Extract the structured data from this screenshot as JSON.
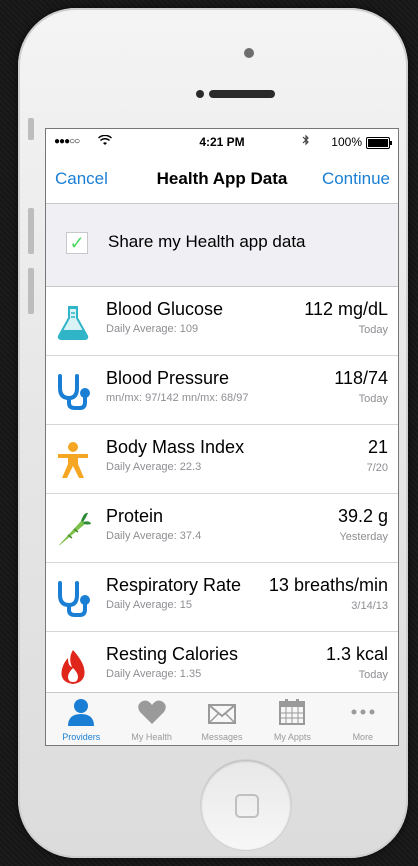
{
  "status_bar": {
    "signal": "●●●○○",
    "wifi_icon": "wifi-icon",
    "time": "4:21 PM",
    "bluetooth_icon": "bluetooth-icon",
    "battery_percent": "100%"
  },
  "nav": {
    "cancel": "Cancel",
    "title": "Health App Data",
    "continue": "Continue"
  },
  "share": {
    "checked": true,
    "check_mark": "✓",
    "label": "Share my Health app data"
  },
  "rows": [
    {
      "icon": "flask-icon",
      "name": "Blood Glucose",
      "sub": "Daily Average: 109",
      "value": "112 mg/dL",
      "date": "Today"
    },
    {
      "icon": "stethoscope-icon",
      "name": "Blood Pressure",
      "sub": "mn/mx: 97/142   mn/mx: 68/97",
      "value": "118/74",
      "date": "Today"
    },
    {
      "icon": "person-icon",
      "name": "Body Mass Index",
      "sub": "Daily Average: 22.3",
      "value": "21",
      "date": "7/20"
    },
    {
      "icon": "carrot-icon",
      "name": "Protein",
      "sub": "Daily Average: 37.4",
      "value": "39.2 g",
      "date": "Yesterday"
    },
    {
      "icon": "stethoscope-icon",
      "name": "Respiratory Rate",
      "sub": "Daily Average: 15",
      "value": "13 breaths/min",
      "date": "3/14/13"
    },
    {
      "icon": "flame-icon",
      "name": "Resting Calories",
      "sub": "Daily Average: 1.35",
      "value": "1.3 kcal",
      "date": "Today"
    }
  ],
  "tabs": [
    {
      "icon": "person-icon",
      "label": "Providers",
      "active": true
    },
    {
      "icon": "heart-icon",
      "label": "My Health",
      "active": false
    },
    {
      "icon": "envelope-icon",
      "label": "Messages",
      "active": false
    },
    {
      "icon": "calendar-icon",
      "label": "My Appts",
      "active": false
    },
    {
      "icon": "more-icon",
      "label": "More",
      "active": false
    }
  ],
  "colors": {
    "accent": "#1a7fd4",
    "check": "#4cd964",
    "flask": "#2fb5c7",
    "stethoscope": "#1a7fd4",
    "person": "#f5a623",
    "carrot": "#4caf50",
    "flame": "#e0261b",
    "tab_inactive": "#9a9a9a"
  }
}
